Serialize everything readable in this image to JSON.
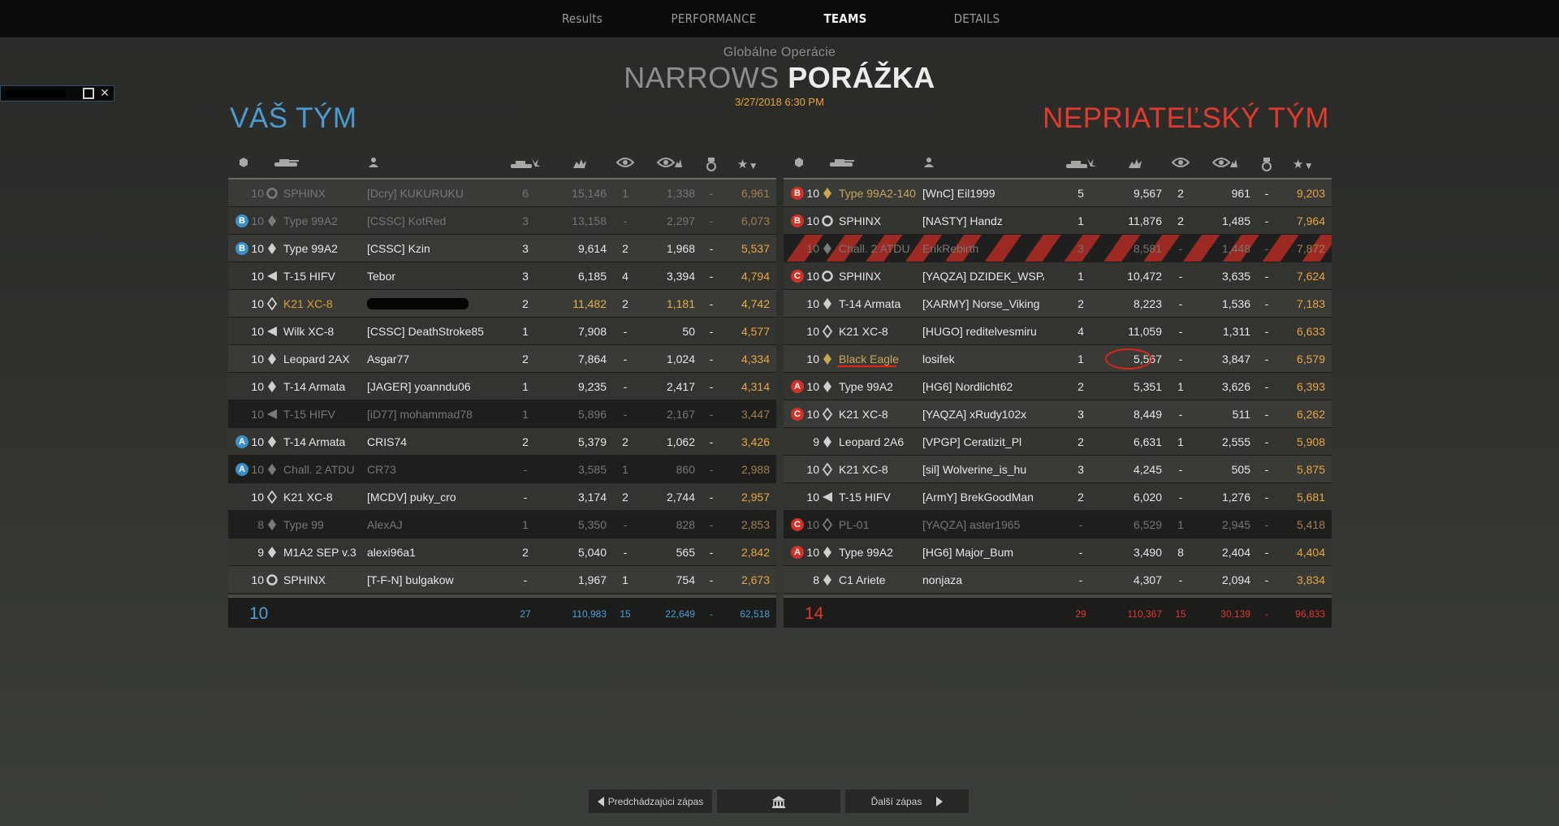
{
  "nav": {
    "tabs": [
      "Results",
      "PERFORMANCE",
      "TEAMS",
      "DETAILS"
    ],
    "active": "TEAMS"
  },
  "header": {
    "mode": "Globálne Operácie",
    "map": "NARROWS",
    "result": "PORÁŽKA",
    "date": "3/27/2018  6:30 PM"
  },
  "teams": {
    "left_title": "VÁŠ TÝM",
    "right_title": "NEPRIATEĽSKÝ TÝM"
  },
  "icons": {
    "col_platoon": "hex-icon",
    "col_tank": "tank-icon",
    "col_player": "person-icon",
    "col_kills": "destroyed-tank-icon",
    "col_damage": "damage-icon",
    "col_spotted": "eye-icon",
    "col_assist": "eye-damage-icon",
    "col_medal": "medal-icon",
    "col_score": "star-sort-icon"
  },
  "colors": {
    "ally": "#4a9bcf",
    "enemy": "#e23a2e",
    "gold": "#e8a642"
  },
  "left_rows": [
    {
      "badge": "",
      "tier": "10",
      "cls": "circle",
      "tank": "SPHINX",
      "player": "[Dcry] KUKURUKU",
      "kills": "6",
      "dmg": "15,146",
      "spot": "1",
      "assist": "1,338",
      "medal": "-",
      "score": "6,961",
      "state": "dead"
    },
    {
      "badge": "B",
      "tier": "10",
      "cls": "diamond",
      "tank": "Type 99A2",
      "player": "[CSSC] KotRed",
      "kills": "3",
      "dmg": "13,158",
      "spot": "-",
      "assist": "2,297",
      "medal": "-",
      "score": "6,073",
      "state": "dead"
    },
    {
      "badge": "B",
      "tier": "10",
      "cls": "diamond",
      "tank": "Type 99A2",
      "player": "[CSSC] Kzin",
      "kills": "3",
      "dmg": "9,614",
      "spot": "2",
      "assist": "1,968",
      "medal": "-",
      "score": "5,537",
      "state": ""
    },
    {
      "badge": "",
      "tier": "10",
      "cls": "td",
      "tank": "T-15 HIFV",
      "player": "Tebor",
      "kills": "3",
      "dmg": "6,185",
      "spot": "4",
      "assist": "3,394",
      "medal": "-",
      "score": "4,794",
      "state": ""
    },
    {
      "badge": "",
      "tier": "10",
      "cls": "diamond-o",
      "tank": "K21 XC-8",
      "player": "",
      "kills": "2",
      "dmg": "11,482",
      "spot": "2",
      "assist": "1,181",
      "medal": "-",
      "score": "4,742",
      "state": "gold"
    },
    {
      "badge": "",
      "tier": "10",
      "cls": "td",
      "tank": "Wilk XC-8",
      "player": "[CSSC] DeathStroke85",
      "kills": "1",
      "dmg": "7,908",
      "spot": "-",
      "assist": "50",
      "medal": "-",
      "score": "4,577",
      "state": ""
    },
    {
      "badge": "",
      "tier": "10",
      "cls": "diamond",
      "tank": "Leopard 2AX",
      "player": "Asgar77",
      "kills": "2",
      "dmg": "7,864",
      "spot": "-",
      "assist": "1,024",
      "medal": "-",
      "score": "4,334",
      "state": ""
    },
    {
      "badge": "",
      "tier": "10",
      "cls": "diamond",
      "tank": "T-14 Armata",
      "player": "[JAGER] yoanndu06",
      "kills": "1",
      "dmg": "9,235",
      "spot": "-",
      "assist": "2,417",
      "medal": "-",
      "score": "4,314",
      "state": ""
    },
    {
      "badge": "",
      "tier": "10",
      "cls": "td",
      "tank": "T-15 HIFV",
      "player": "[iD77] mohammad78",
      "kills": "1",
      "dmg": "5,896",
      "spot": "-",
      "assist": "2,167",
      "medal": "-",
      "score": "3,447",
      "state": "dead dark"
    },
    {
      "badge": "A",
      "tier": "10",
      "cls": "diamond",
      "tank": "T-14 Armata",
      "player": "CRIS74",
      "kills": "2",
      "dmg": "5,379",
      "spot": "2",
      "assist": "1,062",
      "medal": "-",
      "score": "3,426",
      "state": ""
    },
    {
      "badge": "A",
      "tier": "10",
      "cls": "diamond",
      "tank": "Chall. 2 ATDU",
      "player": "CR73",
      "kills": "-",
      "dmg": "3,585",
      "spot": "1",
      "assist": "860",
      "medal": "-",
      "score": "2,988",
      "state": "dead dark"
    },
    {
      "badge": "",
      "tier": "10",
      "cls": "diamond-o",
      "tank": "K21 XC-8",
      "player": "[MCDV] puky_cro",
      "kills": "-",
      "dmg": "3,174",
      "spot": "2",
      "assist": "2,744",
      "medal": "-",
      "score": "2,957",
      "state": ""
    },
    {
      "badge": "",
      "tier": "8",
      "cls": "diamond",
      "tank": "Type 99",
      "player": "AlexAJ",
      "kills": "1",
      "dmg": "5,350",
      "spot": "-",
      "assist": "828",
      "medal": "-",
      "score": "2,853",
      "state": "dead dark"
    },
    {
      "badge": "",
      "tier": "9",
      "cls": "diamond",
      "tank": "M1A2 SEP v.3",
      "player": "alexi96a1",
      "kills": "2",
      "dmg": "5,040",
      "spot": "-",
      "assist": "565",
      "medal": "-",
      "score": "2,842",
      "state": ""
    },
    {
      "badge": "",
      "tier": "10",
      "cls": "circle",
      "tank": "SPHINX",
      "player": "[T-F-N] bulgakow",
      "kills": "-",
      "dmg": "1,967",
      "spot": "1",
      "assist": "754",
      "medal": "-",
      "score": "2,673",
      "state": ""
    }
  ],
  "right_rows": [
    {
      "badge": "B",
      "tier": "10",
      "cls": "diamond-gold",
      "tank": "Type 99A2-140",
      "player": "[WnC] Eil1999",
      "kills": "5",
      "dmg": "9,567",
      "spot": "2",
      "assist": "961",
      "medal": "-",
      "score": "9,203",
      "state": "goldname"
    },
    {
      "badge": "B",
      "tier": "10",
      "cls": "circle",
      "tank": "SPHINX",
      "player": "[NASTY] Handz",
      "kills": "1",
      "dmg": "11,876",
      "spot": "2",
      "assist": "1,485",
      "medal": "-",
      "score": "7,964",
      "state": ""
    },
    {
      "badge": "",
      "tier": "10",
      "cls": "diamond",
      "tank": "Chall. 2 ATDU",
      "player": "ErikRebirth",
      "kills": "3",
      "dmg": "8,581",
      "spot": "-",
      "assist": "1,448",
      "medal": "-",
      "score": "7,872",
      "state": "dead stripes"
    },
    {
      "badge": "C",
      "tier": "10",
      "cls": "circle",
      "tank": "SPHINX",
      "player": "[YAQZA] DZIDEK_WSPAN",
      "kills": "1",
      "dmg": "10,472",
      "spot": "-",
      "assist": "3,635",
      "medal": "-",
      "score": "7,624",
      "state": ""
    },
    {
      "badge": "",
      "tier": "10",
      "cls": "diamond",
      "tank": "T-14 Armata",
      "player": "[XARMY] Norse_Viking",
      "kills": "2",
      "dmg": "8,223",
      "spot": "-",
      "assist": "1,536",
      "medal": "-",
      "score": "7,183",
      "state": ""
    },
    {
      "badge": "",
      "tier": "10",
      "cls": "diamond-o",
      "tank": "K21 XC-8",
      "player": "[HUGO] reditelvesmiru",
      "kills": "4",
      "dmg": "11,059",
      "spot": "-",
      "assist": "1,311",
      "medal": "-",
      "score": "6,633",
      "state": ""
    },
    {
      "badge": "",
      "tier": "10",
      "cls": "diamond-gold",
      "tank": "Black Eagle",
      "player": "losifek",
      "kills": "1",
      "dmg": "5,567",
      "spot": "-",
      "assist": "3,847",
      "medal": "-",
      "score": "6,579",
      "state": "goldname marked"
    },
    {
      "badge": "A",
      "tier": "10",
      "cls": "diamond",
      "tank": "Type 99A2",
      "player": "[HG6] Nordlicht62",
      "kills": "2",
      "dmg": "5,351",
      "spot": "1",
      "assist": "3,626",
      "medal": "-",
      "score": "6,393",
      "state": ""
    },
    {
      "badge": "C",
      "tier": "10",
      "cls": "diamond-o",
      "tank": "K21 XC-8",
      "player": "[YAQZA] xRudy102x",
      "kills": "3",
      "dmg": "8,449",
      "spot": "-",
      "assist": "511",
      "medal": "-",
      "score": "6,262",
      "state": ""
    },
    {
      "badge": "",
      "tier": "9",
      "cls": "diamond",
      "tank": "Leopard 2A6",
      "player": "[VPGP] Ceratizit_Pl",
      "kills": "2",
      "dmg": "6,631",
      "spot": "1",
      "assist": "2,555",
      "medal": "-",
      "score": "5,908",
      "state": ""
    },
    {
      "badge": "",
      "tier": "10",
      "cls": "diamond-o",
      "tank": "K21 XC-8",
      "player": "[sil] Wolverine_is_hu",
      "kills": "3",
      "dmg": "4,245",
      "spot": "-",
      "assist": "505",
      "medal": "-",
      "score": "5,875",
      "state": ""
    },
    {
      "badge": "",
      "tier": "10",
      "cls": "td",
      "tank": "T-15 HIFV",
      "player": "[ArmY] BrekGoodMan",
      "kills": "2",
      "dmg": "6,020",
      "spot": "-",
      "assist": "1,276",
      "medal": "-",
      "score": "5,681",
      "state": ""
    },
    {
      "badge": "C",
      "tier": "10",
      "cls": "diamond-o",
      "tank": "PL-01",
      "player": "[YAQZA] aster1965",
      "kills": "-",
      "dmg": "6,529",
      "spot": "1",
      "assist": "2,945",
      "medal": "-",
      "score": "5,418",
      "state": "dead dark"
    },
    {
      "badge": "A",
      "tier": "10",
      "cls": "diamond",
      "tank": "Type 99A2",
      "player": "[HG6] Major_Bum",
      "kills": "-",
      "dmg": "3,490",
      "spot": "8",
      "assist": "2,404",
      "medal": "-",
      "score": "4,404",
      "state": ""
    },
    {
      "badge": "",
      "tier": "8",
      "cls": "diamond",
      "tank": "C1 Ariete",
      "player": "nonjaza",
      "kills": "-",
      "dmg": "4,307",
      "spot": "-",
      "assist": "2,094",
      "medal": "-",
      "score": "3,834",
      "state": ""
    }
  ],
  "left_totals": {
    "players": "10",
    "kills": "27",
    "dmg": "110,983",
    "spot": "15",
    "assist": "22,649",
    "medal": "-",
    "score": "62,518"
  },
  "right_totals": {
    "players": "14",
    "kills": "29",
    "dmg": "110,367",
    "spot": "15",
    "assist": "30,139",
    "medal": "-",
    "score": "96,833"
  },
  "footer": {
    "prev": "Predchádzajúci zápas",
    "home": "home-icon",
    "next": "Ďalší zápas"
  }
}
